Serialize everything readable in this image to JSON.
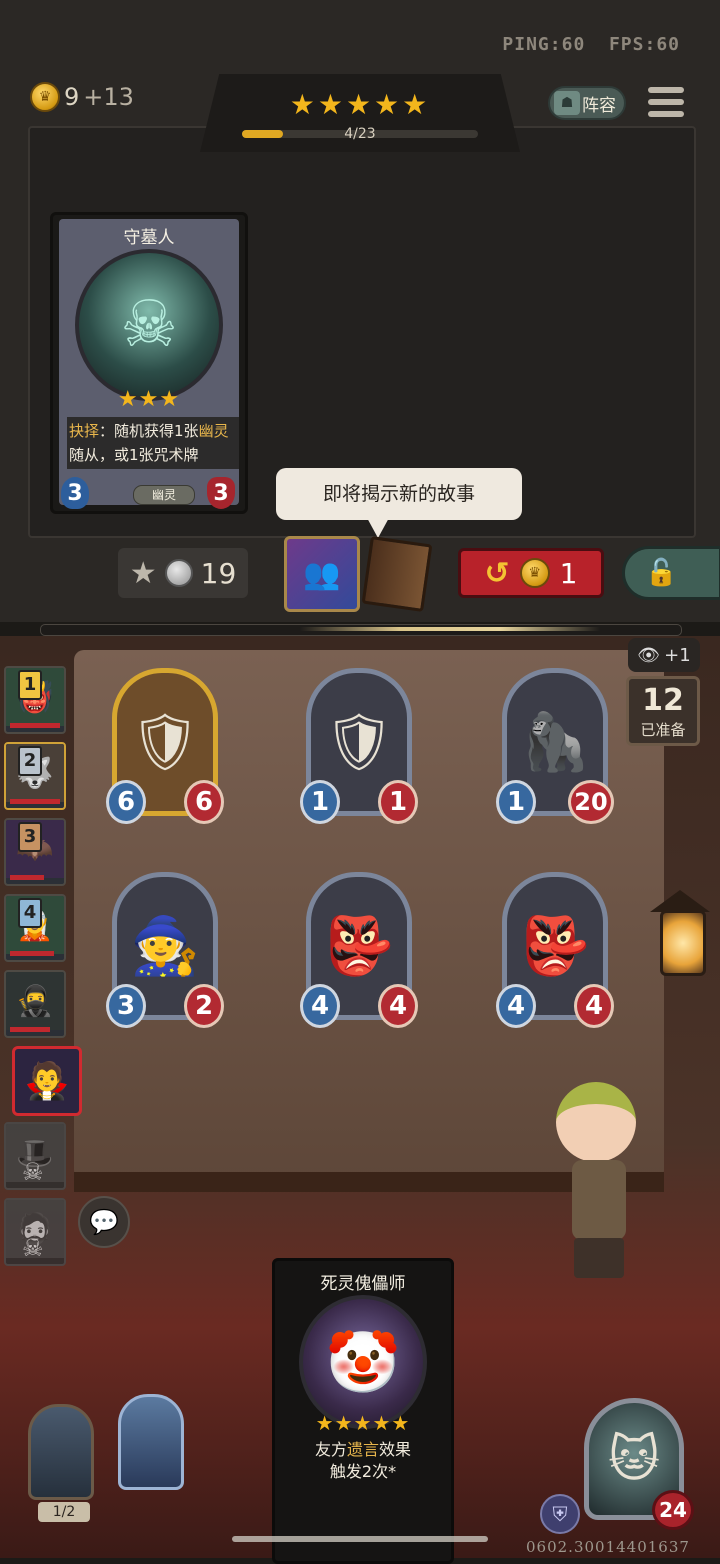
{
  "status": {
    "ping": "PING:60",
    "fps": "FPS:60"
  },
  "gold": {
    "amount": "9",
    "income": "+13"
  },
  "tavern": {
    "stars": "★★★★★",
    "progress": "4/23",
    "progress_fraction": 0.174
  },
  "lineup_label": "阵容",
  "shop_card": {
    "name": "守墓人",
    "stars": "★★★",
    "text_keyword": "抉择",
    "text_pre": "：随机获得1张",
    "text_kw2": "幽灵",
    "text_post": "随从，或1张咒术牌",
    "attack": "3",
    "health": "3",
    "tribe": "幽灵"
  },
  "speech_bubble": "即将揭示新的故事",
  "upgrade": {
    "cost": "19"
  },
  "refresh": {
    "cost": "1"
  },
  "board": {
    "minions": [
      {
        "attack": "6",
        "health": "6",
        "golden": true,
        "icon": "knight"
      },
      {
        "attack": "1",
        "health": "1",
        "golden": false,
        "icon": "knight"
      },
      {
        "attack": "1",
        "health": "20",
        "golden": false,
        "icon": "dark-beast"
      },
      {
        "attack": "3",
        "health": "2",
        "golden": false,
        "icon": "hooded-monk"
      },
      {
        "attack": "4",
        "health": "4",
        "golden": false,
        "icon": "brute"
      },
      {
        "attack": "4",
        "health": "4",
        "golden": false,
        "icon": "brute"
      }
    ]
  },
  "vision": {
    "bonus": "+1"
  },
  "ready": {
    "count": "12",
    "label": "已准备"
  },
  "heroes": [
    {
      "rank": "1"
    },
    {
      "rank": "2"
    },
    {
      "rank": "3"
    },
    {
      "rank": "4"
    }
  ],
  "discover_card": {
    "name": "死灵傀儡师",
    "stars": "★★★★★",
    "line1_pre": "友方",
    "line1_kw": "遗言",
    "line1_post": "效果",
    "line2": "触发2次*"
  },
  "hand": {
    "count": "1/2"
  },
  "player": {
    "health": "24"
  },
  "watermark": "0602.30014401637",
  "colors": {
    "gold": "#f3b61c",
    "attack": "#37689f",
    "health": "#b22a32",
    "refresh": "#b8222a"
  }
}
